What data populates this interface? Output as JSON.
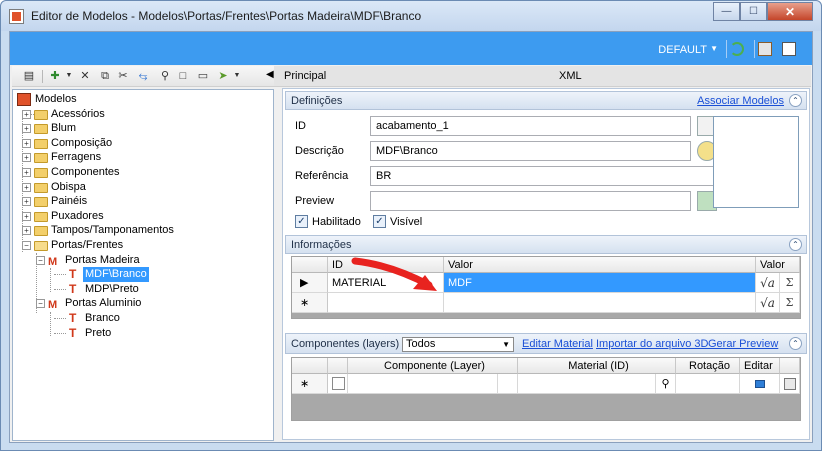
{
  "window": {
    "title": "Editor de Modelos - Modelos\\Portas/Frentes\\Portas Madeira\\MDF\\Branco"
  },
  "header": {
    "profile": "DEFAULT"
  },
  "tree": {
    "root": "Modelos",
    "items": [
      {
        "label": "Acessórios"
      },
      {
        "label": "Blum"
      },
      {
        "label": "Composição"
      },
      {
        "label": "Ferragens"
      },
      {
        "label": "Componentes"
      },
      {
        "label": "Obispa"
      },
      {
        "label": "Painéis"
      },
      {
        "label": "Puxadores"
      },
      {
        "label": "Tampos/Tamponamentos"
      },
      {
        "label": "Portas/Frentes"
      }
    ],
    "portas_madeira": "Portas Madeira",
    "madeira_children": [
      "MDF\\Branco",
      "MDP\\Preto"
    ],
    "portas_aluminio": "Portas Aluminio",
    "aluminio_children": [
      "Branco",
      "Preto"
    ]
  },
  "tabs": {
    "principal": "Principal",
    "xml": "XML"
  },
  "definicoes": {
    "title": "Definições",
    "link": "Associar Modelos",
    "id_label": "ID",
    "id_value": "acabamento_1",
    "descricao_label": "Descrição",
    "descricao_value": "MDF\\Branco",
    "referencia_label": "Referência",
    "referencia_value": "BR",
    "preview_label": "Preview",
    "preview_value": "",
    "habilitado": "Habilitado",
    "visivel": "Visível"
  },
  "informacoes": {
    "title": "Informações",
    "columns": [
      "ID",
      "Valor",
      "Valor"
    ],
    "rows": [
      {
        "id": "MATERIAL",
        "valor": "MDF"
      }
    ]
  },
  "componentes": {
    "title": "Componentes (layers)",
    "filter": "Todos",
    "links": [
      "Editar Material",
      "Importar do arquivo 3D",
      "Gerar Preview"
    ],
    "columns": [
      "Componente (Layer)",
      "Material (ID)",
      "Rotação",
      "Editar"
    ]
  },
  "colors": {
    "accent": "#3d9bf0",
    "selection": "#3399ff",
    "arrow": "#e8231f"
  }
}
